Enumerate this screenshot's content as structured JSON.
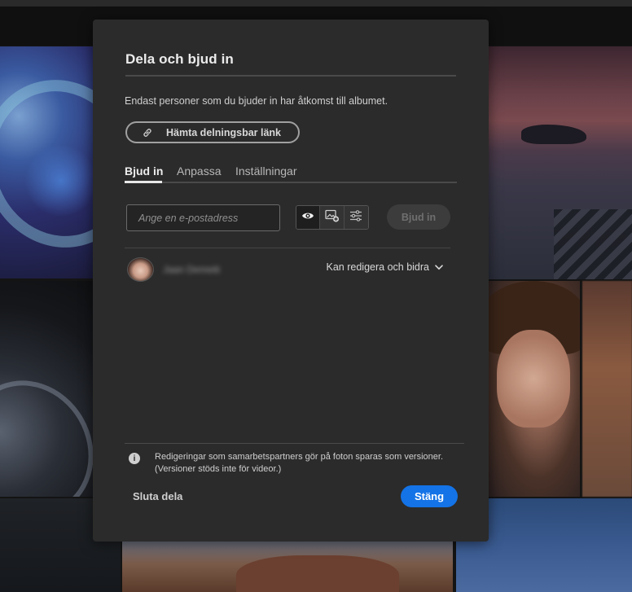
{
  "dialog": {
    "title": "Dela och bjud in",
    "description": "Endast personer som du bjuder in har åtkomst till albumet.",
    "get_link_label": "Hämta delningsbar länk",
    "link_icon": "link-icon"
  },
  "tabs": [
    {
      "label": "Bjud in",
      "active": true
    },
    {
      "label": "Anpassa",
      "active": false
    },
    {
      "label": "Inställningar",
      "active": false
    }
  ],
  "invite": {
    "email_placeholder": "Ange en e-postadress",
    "permission_icons": [
      "eye-icon",
      "add-photo-icon",
      "sliders-icon"
    ],
    "invite_label": "Bjud in"
  },
  "member": {
    "name": "Jaan Demeiti",
    "role": "Kan redigera och bidra"
  },
  "footer": {
    "note_line1": "Redigeringar som samarbetspartners gör på foton sparas som versioner.",
    "note_line2": "(Versioner stöds inte för videor.)",
    "stop_sharing_label": "Sluta dela",
    "close_label": "Stäng"
  },
  "colors": {
    "accent": "#1473e6",
    "dialog_bg": "#2b2b2b"
  }
}
